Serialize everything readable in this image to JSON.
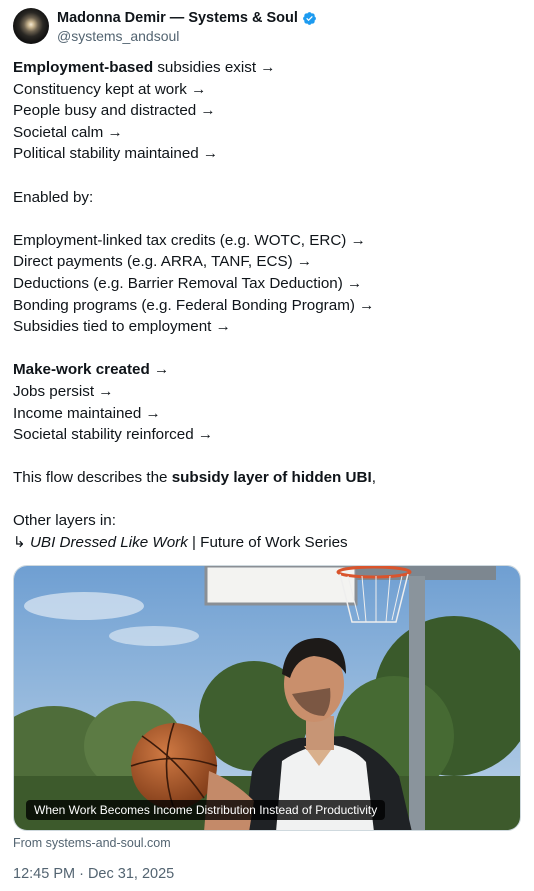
{
  "author": {
    "name": "Madonna Demir — Systems & Soul",
    "handle": "@systems_andsoul",
    "verified": true,
    "verified_color": "#1d9bf0"
  },
  "post": {
    "block1": {
      "l1_bold": "Employment-based",
      "l1_rest": " subsidies exist →",
      "l2": "Constituency kept at work →",
      "l3": "People busy and distracted →",
      "l4": "Societal calm →",
      "l5": "Political stability maintained →"
    },
    "enabled_by": "Enabled by:",
    "block2": {
      "l1": "Employment-linked tax credits (e.g. WOTC, ERC) →",
      "l2": "Direct payments (e.g. ARRA, TANF, ECS) →",
      "l3": "Deductions (e.g. Barrier Removal Tax Deduction) →",
      "l4": "Bonding programs (e.g. Federal Bonding Program) →",
      "l5": "Subsidies tied to employment →"
    },
    "block3": {
      "l1_bold": "Make-work created",
      "l1_rest": " →",
      "l2": "Jobs persist →",
      "l3": "Income maintained →",
      "l4": "Societal stability reinforced →"
    },
    "summary": {
      "prefix": "This flow describes the ",
      "bold": "subsidy layer of hidden UBI",
      "suffix": ","
    },
    "other_layers": {
      "intro": "Other layers in:",
      "arrow": "↳",
      "italic_link": "UBI Dressed Like Work",
      "rest": " | Future of Work Series"
    }
  },
  "card": {
    "caption": "When Work Becomes Income Distribution Instead of Productivity",
    "source": "From systems-and-soul.com"
  },
  "timestamp": "12:45 PM · Dec 31, 2025"
}
